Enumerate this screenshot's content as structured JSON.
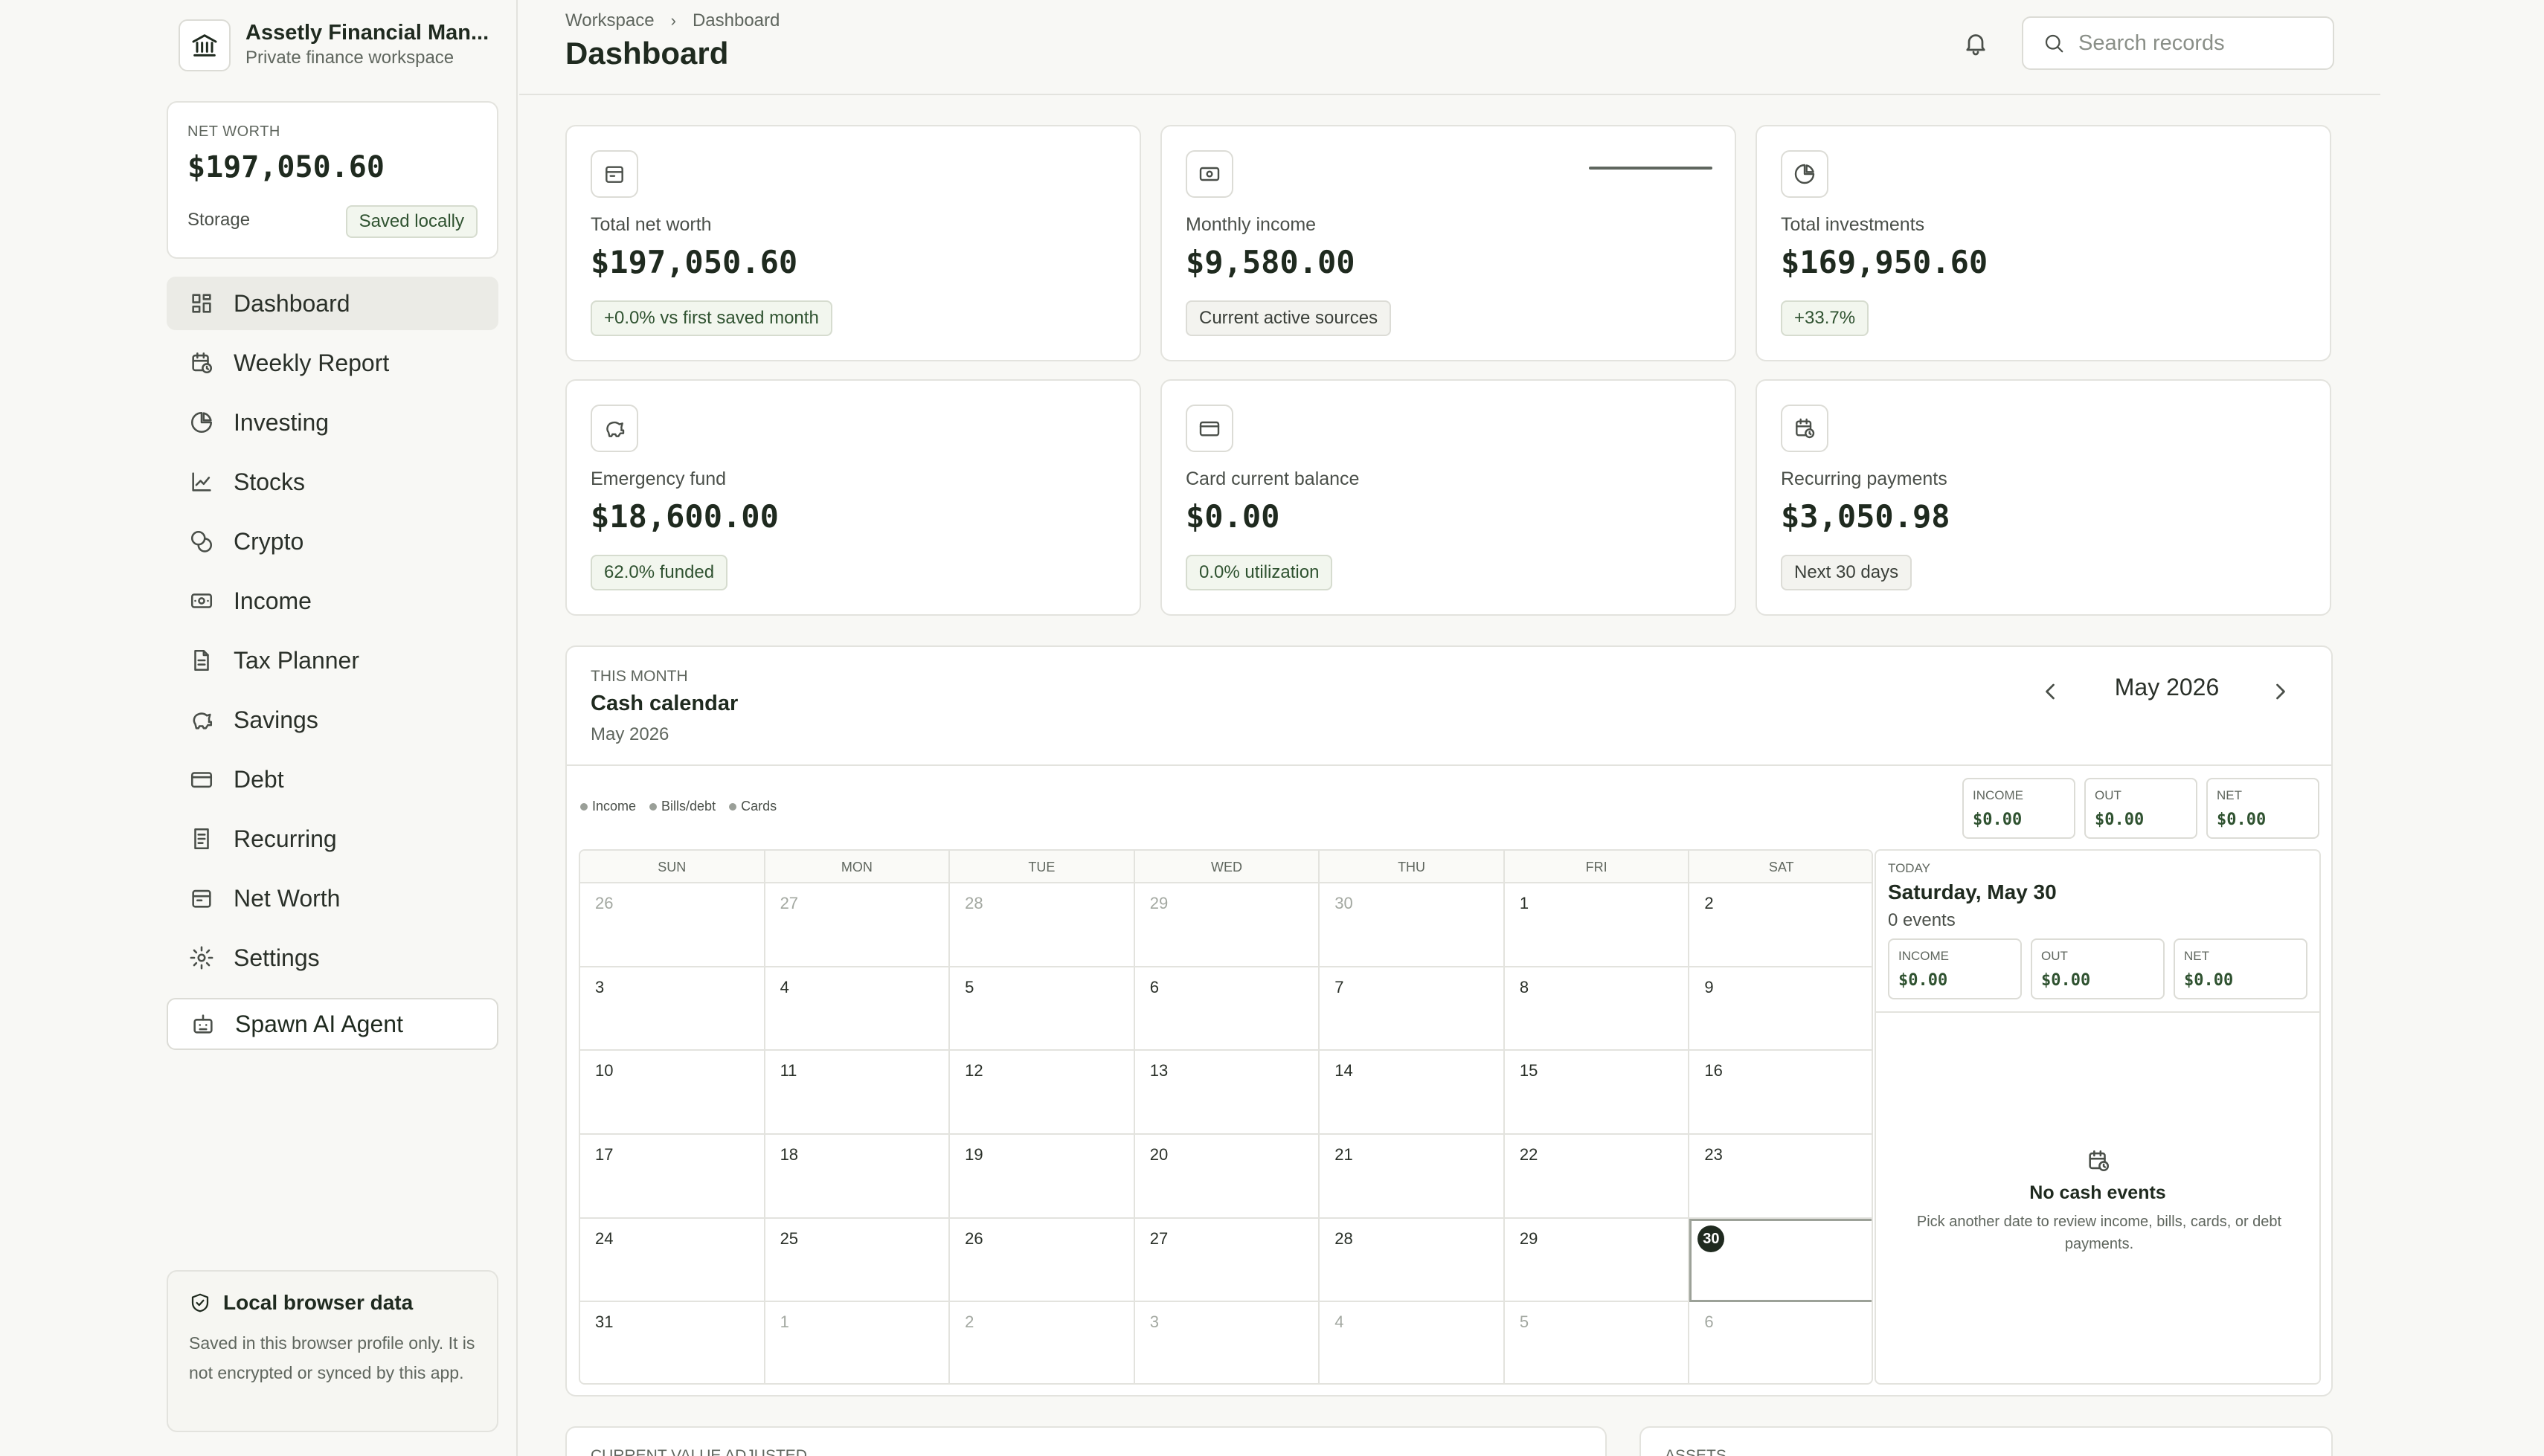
{
  "app": {
    "name": "Assetly Financial Man...",
    "subtitle": "Private finance workspace"
  },
  "sidebar": {
    "net_worth": {
      "label": "NET WORTH",
      "value": "$197,050.60",
      "storage_label": "Storage",
      "storage_badge": "Saved locally"
    },
    "items": [
      {
        "label": "Dashboard",
        "icon": "grid-icon",
        "active": true
      },
      {
        "label": "Weekly Report",
        "icon": "calendar-clock-icon"
      },
      {
        "label": "Investing",
        "icon": "pie-chart-icon"
      },
      {
        "label": "Stocks",
        "icon": "line-chart-icon"
      },
      {
        "label": "Crypto",
        "icon": "coins-icon"
      },
      {
        "label": "Income",
        "icon": "banknote-icon"
      },
      {
        "label": "Tax Planner",
        "icon": "file-text-icon"
      },
      {
        "label": "Savings",
        "icon": "piggy-bank-icon"
      },
      {
        "label": "Debt",
        "icon": "credit-card-icon"
      },
      {
        "label": "Recurring",
        "icon": "receipt-icon"
      },
      {
        "label": "Net Worth",
        "icon": "wallet-icon"
      },
      {
        "label": "Settings",
        "icon": "gear-icon"
      }
    ],
    "spawn_label": "Spawn AI Agent",
    "local_data": {
      "title": "Local browser data",
      "text": "Saved in this browser profile only. It is not encrypted or synced by this app."
    }
  },
  "header": {
    "breadcrumb": [
      "Workspace",
      "Dashboard"
    ],
    "title": "Dashboard",
    "search_placeholder": "Search records"
  },
  "stats": [
    {
      "label": "Total net worth",
      "value": "$197,050.60",
      "badge": "+0.0% vs first saved month",
      "icon": "wallet-icon"
    },
    {
      "label": "Monthly income",
      "value": "$9,580.00",
      "badge": "Current active sources",
      "icon": "banknote-icon"
    },
    {
      "label": "Total investments",
      "value": "$169,950.60",
      "badge": "+33.7%",
      "icon": "pie-chart-icon"
    },
    {
      "label": "Emergency fund",
      "value": "$18,600.00",
      "badge": "62.0% funded",
      "icon": "piggy-bank-icon"
    },
    {
      "label": "Card current balance",
      "value": "$0.00",
      "badge": "0.0% utilization",
      "icon": "credit-card-icon"
    },
    {
      "label": "Recurring payments",
      "value": "$3,050.98",
      "badge": "Next 30 days",
      "icon": "calendar-clock-icon"
    }
  ],
  "calendar": {
    "eyebrow": "THIS MONTH",
    "title": "Cash calendar",
    "subtitle": "May 2026",
    "month_label": "May 2026",
    "legend": [
      "Income",
      "Bills/debt",
      "Cards"
    ],
    "summary": [
      {
        "label": "INCOME",
        "value": "$0.00"
      },
      {
        "label": "OUT",
        "value": "$0.00"
      },
      {
        "label": "NET",
        "value": "$0.00"
      }
    ],
    "weekdays": [
      "SUN",
      "MON",
      "TUE",
      "WED",
      "THU",
      "FRI",
      "SAT"
    ],
    "weeks": [
      [
        "26",
        "27",
        "28",
        "29",
        "30",
        "1",
        "2"
      ],
      [
        "3",
        "4",
        "5",
        "6",
        "7",
        "8",
        "9"
      ],
      [
        "10",
        "11",
        "12",
        "13",
        "14",
        "15",
        "16"
      ],
      [
        "17",
        "18",
        "19",
        "20",
        "21",
        "22",
        "23"
      ],
      [
        "24",
        "25",
        "26",
        "27",
        "28",
        "29",
        "30"
      ],
      [
        "31",
        "1",
        "2",
        "3",
        "4",
        "5",
        "6"
      ]
    ],
    "today": {
      "eyebrow": "TODAY",
      "title": "Saturday, May 30",
      "count": "0 events",
      "summary": [
        {
          "label": "INCOME",
          "value": "$0.00"
        },
        {
          "label": "OUT",
          "value": "$0.00"
        },
        {
          "label": "NET",
          "value": "$0.00"
        }
      ],
      "empty_title": "No cash events",
      "empty_text": "Pick another date to review income, bills, cards, or debt payments."
    }
  },
  "bottom_cards": [
    "CURRENT VALUE ADJUSTED",
    "ASSETS"
  ]
}
